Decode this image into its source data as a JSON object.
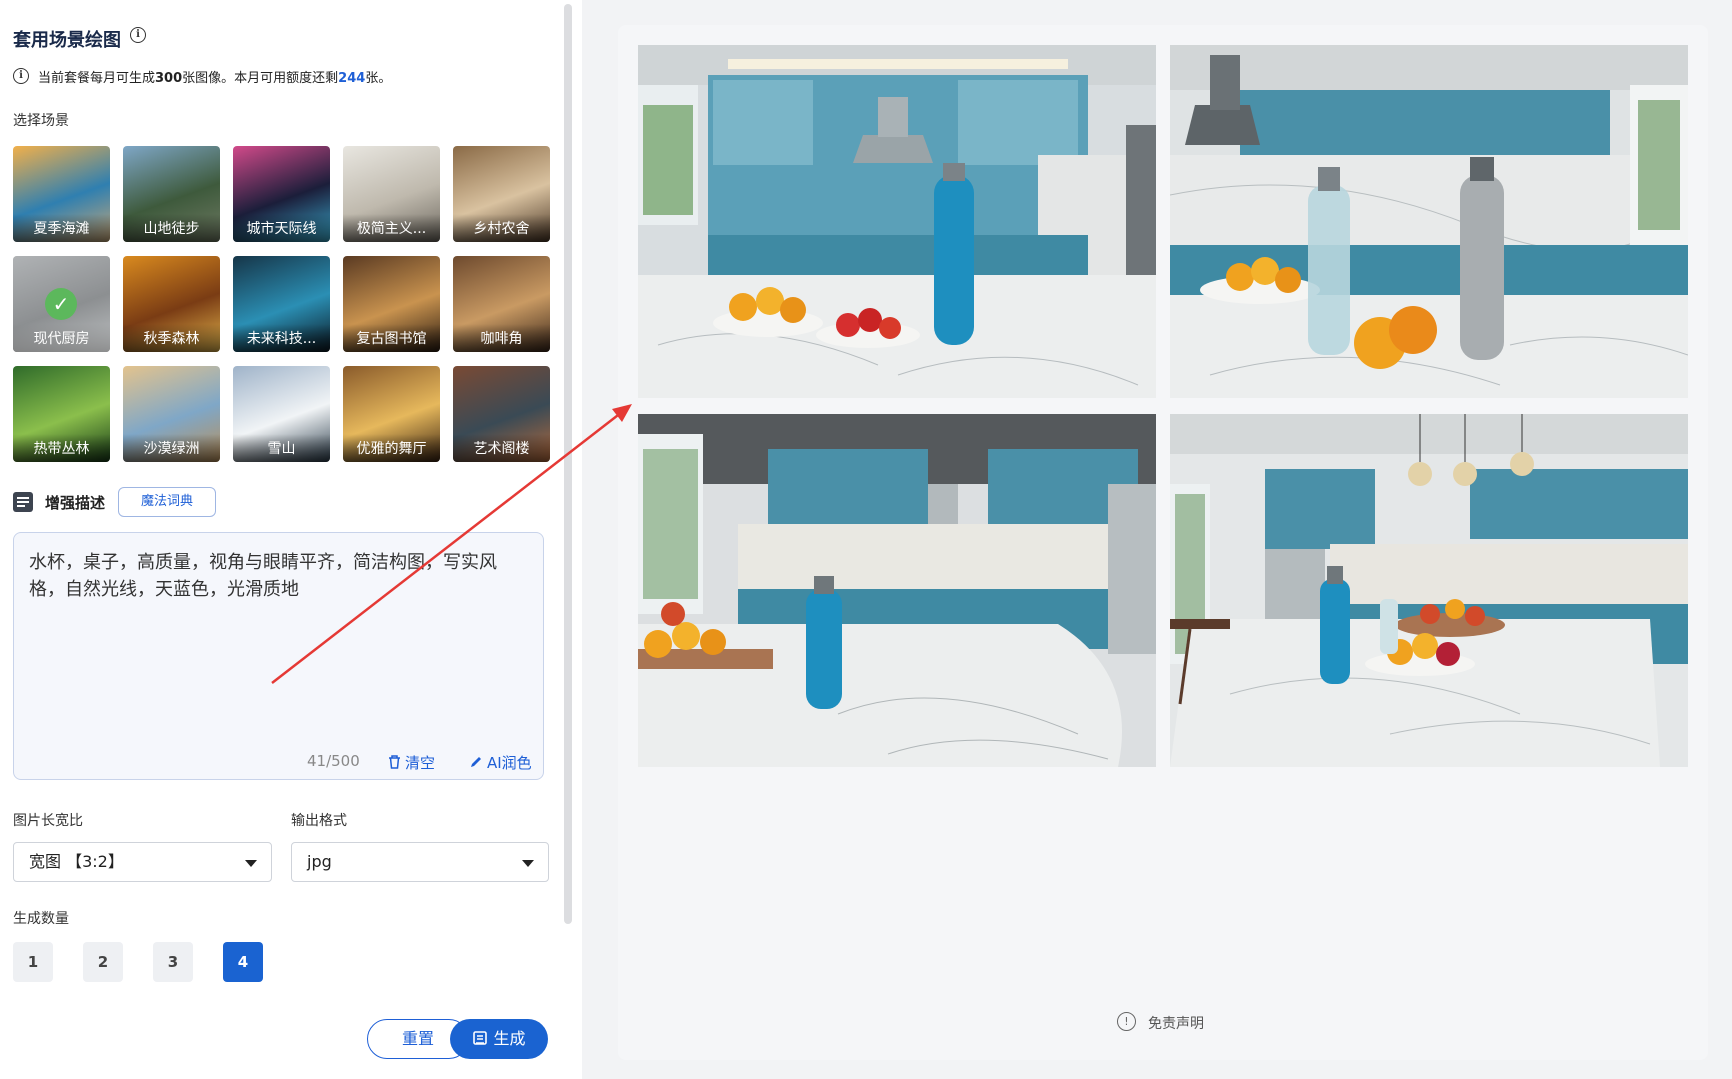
{
  "panel": {
    "title": "套用场景绘图",
    "quota_prefix": "当前套餐每月可生成",
    "quota_monthly": "300",
    "quota_mid": "张图像。本月可用额度还剩",
    "quota_remaining": "244",
    "quota_suffix": "张。",
    "scene_label": "选择场景"
  },
  "scenes": [
    {
      "label": "夏季海滩",
      "icon": "beach"
    },
    {
      "label": "山地徒步",
      "icon": "mountain"
    },
    {
      "label": "城市天际线",
      "icon": "city"
    },
    {
      "label": "极简主义...",
      "icon": "minimal"
    },
    {
      "label": "乡村农舍",
      "icon": "farmhouse"
    },
    {
      "label": "现代厨房",
      "icon": "kitchen",
      "selected": true
    },
    {
      "label": "秋季森林",
      "icon": "forest"
    },
    {
      "label": "未来科技...",
      "icon": "tech"
    },
    {
      "label": "复古图书馆",
      "icon": "library"
    },
    {
      "label": "咖啡角",
      "icon": "cafe"
    },
    {
      "label": "热带丛林",
      "icon": "jungle"
    },
    {
      "label": "沙漠绿洲",
      "icon": "desert"
    },
    {
      "label": "雪山",
      "icon": "snow"
    },
    {
      "label": "优雅的舞厅",
      "icon": "ballroom"
    },
    {
      "label": "艺术阁楼",
      "icon": "loft"
    }
  ],
  "enhance": {
    "label": "增强描述",
    "magic_button": "魔法词典",
    "text": "水杯，桌子，高质量，视角与眼睛平齐，简洁构图，写实风格，自然光线，天蓝色，光滑质地",
    "count": "41/500",
    "clear": "清空",
    "ai": "AI润色"
  },
  "options": {
    "ratio_label": "图片长宽比",
    "ratio_value": "宽图 【3:2】",
    "format_label": "输出格式",
    "format_value": "jpg",
    "quantity_label": "生成数量",
    "quantities": [
      "1",
      "2",
      "3",
      "4"
    ],
    "quantity_selected": "4"
  },
  "actions": {
    "reset": "重置",
    "generate": "生成"
  },
  "results": {
    "disclaimer": "免责声明",
    "images": [
      "kitchen-result-1",
      "kitchen-result-2",
      "kitchen-result-3",
      "kitchen-result-4"
    ]
  },
  "colors": {
    "accent": "#1a63d1",
    "cabinet_blue": "#4a90a8",
    "bottle_blue": "#1e8fbf",
    "annotation_arrow": "#e53935"
  }
}
